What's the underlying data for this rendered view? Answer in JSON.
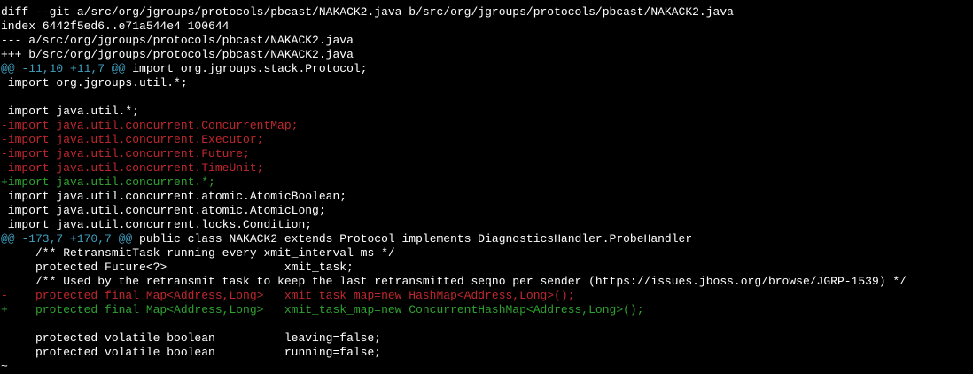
{
  "terminal": {
    "colors": {
      "background": "#000000",
      "header": "#ffffff",
      "hunk": "#3fa0c0",
      "context": "#ffffff",
      "deleted": "#c0272d",
      "added": "#2fa32f"
    },
    "lines": [
      {
        "type": "hdr",
        "text": "diff --git a/src/org/jgroups/protocols/pbcast/NAKACK2.java b/src/org/jgroups/protocols/pbcast/NAKACK2.java"
      },
      {
        "type": "hdr",
        "text": "index 6442f5ed6..e71a544e4 100644"
      },
      {
        "type": "hdr",
        "text": "--- a/src/org/jgroups/protocols/pbcast/NAKACK2.java"
      },
      {
        "type": "hdr",
        "text": "+++ b/src/org/jgroups/protocols/pbcast/NAKACK2.java"
      },
      {
        "type": "hunk",
        "marker": "@@ -11,10 +11,7 @@",
        "rest": " import org.jgroups.stack.Protocol;"
      },
      {
        "type": "ctx",
        "text": " import org.jgroups.util.*;"
      },
      {
        "type": "ctx",
        "text": " "
      },
      {
        "type": "ctx",
        "text": " import java.util.*;"
      },
      {
        "type": "del",
        "text": "-import java.util.concurrent.ConcurrentMap;"
      },
      {
        "type": "del",
        "text": "-import java.util.concurrent.Executor;"
      },
      {
        "type": "del",
        "text": "-import java.util.concurrent.Future;"
      },
      {
        "type": "del",
        "text": "-import java.util.concurrent.TimeUnit;"
      },
      {
        "type": "add",
        "text": "+import java.util.concurrent.*;"
      },
      {
        "type": "ctx",
        "text": " import java.util.concurrent.atomic.AtomicBoolean;"
      },
      {
        "type": "ctx",
        "text": " import java.util.concurrent.atomic.AtomicLong;"
      },
      {
        "type": "ctx",
        "text": " import java.util.concurrent.locks.Condition;"
      },
      {
        "type": "hunk",
        "marker": "@@ -173,7 +170,7 @@",
        "rest": " public class NAKACK2 extends Protocol implements DiagnosticsHandler.ProbeHandler"
      },
      {
        "type": "ctx",
        "text": "     /** RetransmitTask running every xmit_interval ms */"
      },
      {
        "type": "ctx",
        "text": "     protected Future<?>                 xmit_task;"
      },
      {
        "type": "ctx",
        "text": "     /** Used by the retransmit task to keep the last retransmitted seqno per sender (https://issues.jboss.org/browse/JGRP-1539) */"
      },
      {
        "type": "del",
        "text": "-    protected final Map<Address,Long>   xmit_task_map=new HashMap<Address,Long>();"
      },
      {
        "type": "add",
        "text": "+    protected final Map<Address,Long>   xmit_task_map=new ConcurrentHashMap<Address,Long>();"
      },
      {
        "type": "ctx",
        "text": " "
      },
      {
        "type": "ctx",
        "text": "     protected volatile boolean          leaving=false;"
      },
      {
        "type": "ctx",
        "text": "     protected volatile boolean          running=false;"
      },
      {
        "type": "tilde",
        "text": "~"
      }
    ]
  }
}
